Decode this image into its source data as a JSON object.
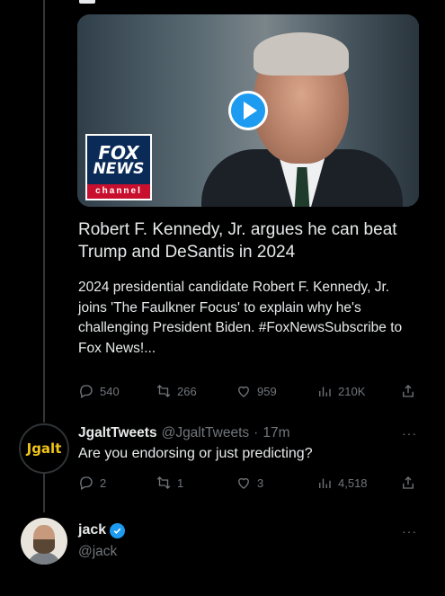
{
  "quoted_tweet": {
    "card": {
      "logo_line1": "FOX",
      "logo_line2": "NEWS",
      "logo_line3": "channel",
      "title": "Robert F. Kennedy, Jr. argues he can beat Trump and DeSantis in 2024",
      "description": "2024 presidential candidate Robert F. Kennedy, Jr. joins 'The Faulkner Focus' to explain why he's challenging President Biden. #FoxNewsSubscribe to Fox News!..."
    },
    "actions": {
      "replies": "540",
      "retweets": "266",
      "likes": "959",
      "views": "210K"
    }
  },
  "reply": {
    "avatar_text": "Jgalt",
    "name": "JgaltTweets",
    "handle": "@JgaltTweets",
    "separator": "·",
    "time": "17m",
    "more": "···",
    "text": "Are you endorsing or just predicting?",
    "actions": {
      "replies": "2",
      "retweets": "1",
      "likes": "3",
      "views": "4,518"
    }
  },
  "next_author": {
    "name": "jack",
    "handle": "@jack",
    "more": "···"
  },
  "colors": {
    "accent": "#1d9bf0",
    "muted": "#71767b",
    "text": "#e7e9ea",
    "background": "#000000"
  },
  "icons": [
    "reply-icon",
    "retweet-icon",
    "like-icon",
    "views-icon",
    "share-icon",
    "play-icon",
    "verified-badge-icon"
  ]
}
